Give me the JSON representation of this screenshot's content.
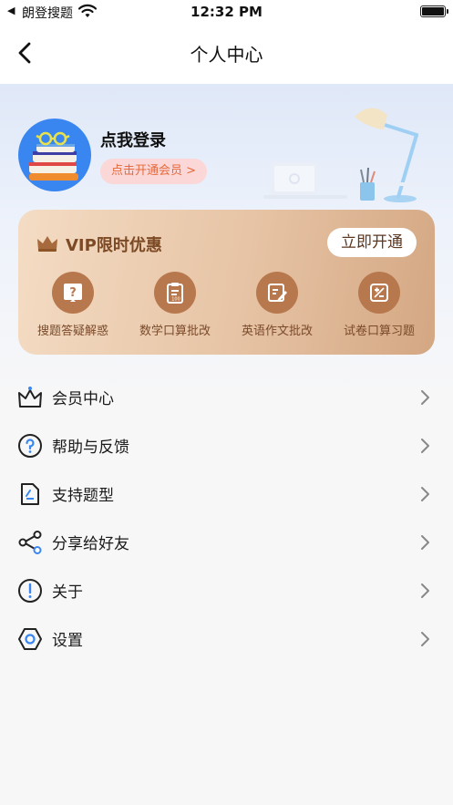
{
  "status_bar": {
    "back_glyph": "◀",
    "app_name": "朗登搜题",
    "time": "12:32 PM",
    "wifi_icon": "wifi-icon",
    "battery_icon": "battery-icon"
  },
  "nav": {
    "title": "个人中心",
    "back_icon": "chevron-left-icon"
  },
  "profile": {
    "login_label": "点我登录",
    "member_pill": "点击开通会员 >"
  },
  "vip": {
    "title": "VIP限时优惠",
    "open_button": "立即开通",
    "features": [
      {
        "label": "搜题答疑解惑",
        "icon": "question-mark-icon"
      },
      {
        "label": "数学口算批改",
        "icon": "clipboard-icon"
      },
      {
        "label": "英语作文批改",
        "icon": "edit-icon"
      },
      {
        "label": "试卷口算习题",
        "icon": "plus-minus-icon"
      }
    ]
  },
  "menu": [
    {
      "label": "会员中心",
      "icon": "crown-icon"
    },
    {
      "label": "帮助与反馈",
      "icon": "help-circle-icon"
    },
    {
      "label": "支持题型",
      "icon": "document-icon"
    },
    {
      "label": "分享给好友",
      "icon": "share-icon"
    },
    {
      "label": "关于",
      "icon": "info-icon"
    },
    {
      "label": "设置",
      "icon": "settings-hexagon-icon"
    }
  ],
  "colors": {
    "accent_blue": "#3a86f0",
    "vip_brown": "#7c4a25",
    "pill_bg": "#fbd7d7",
    "pill_text": "#e66a3b"
  }
}
